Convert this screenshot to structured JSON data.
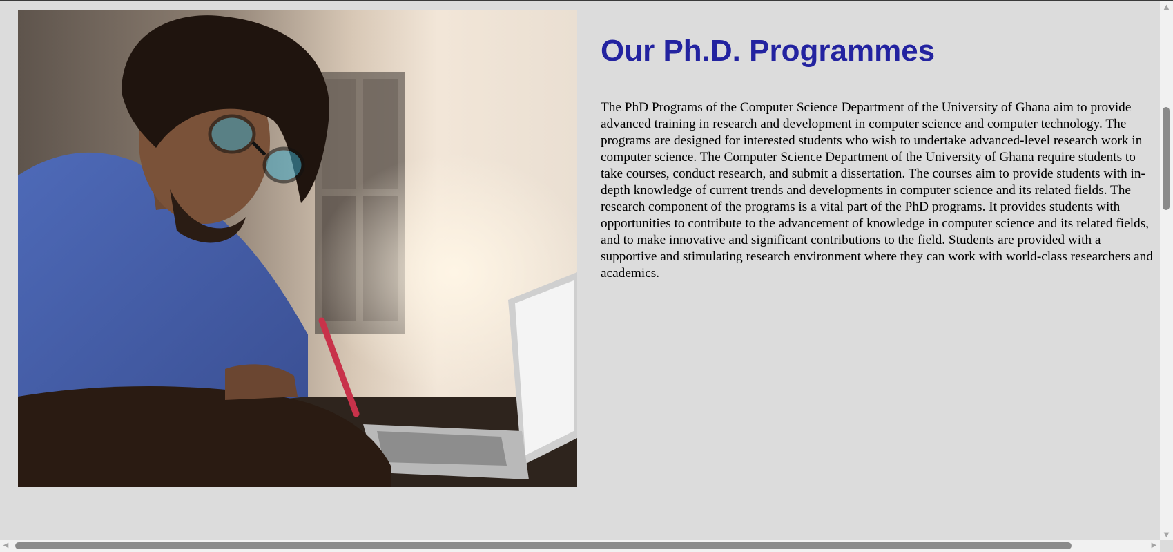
{
  "section": {
    "heading": "Our Ph.D. Programmes",
    "body": "The PhD Programs of the Computer Science Department of the University of Ghana aim to provide advanced training in research and development in computer science and computer technology. The programs are designed for interested students who wish to undertake advanced-level research work in computer science. The Computer Science Department of the University of Ghana require students to take courses, conduct research, and submit a dissertation. The courses aim to provide students with in-depth knowledge of current trends and developments in computer science and its related fields. The research component of the programs is a vital part of the PhD programs. It provides students with opportunities to contribute to the advancement of knowledge in computer science and its related fields, and to make innovative and significant contributions to the field. Students are provided with a supportive and stimulating research environment where they can work with world-class researchers and academics.",
    "image_icon": "photo-student-laptop"
  },
  "colors": {
    "background": "#dcdcdc",
    "heading": "#2323a0",
    "text": "#000000",
    "scrollbar_thumb": "#8a8a8a"
  },
  "scrollbars": {
    "up_icon": "▲",
    "down_icon": "▼",
    "left_icon": "◀",
    "right_icon": "▶"
  }
}
